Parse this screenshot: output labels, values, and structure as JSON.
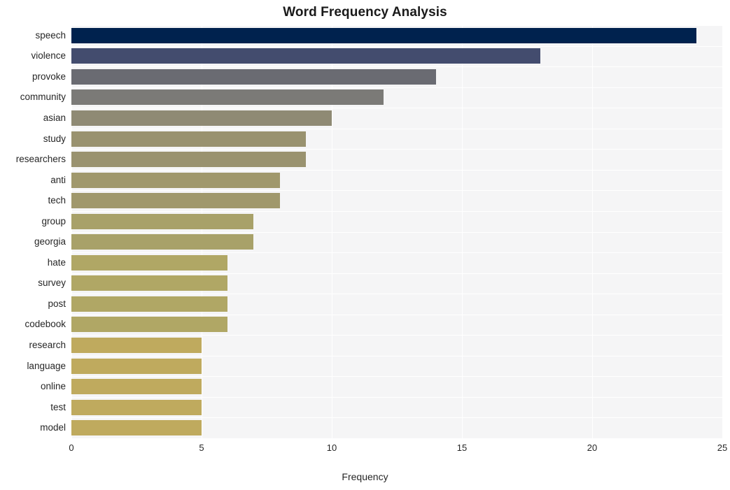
{
  "chart_data": {
    "type": "bar",
    "orientation": "horizontal",
    "title": "Word Frequency Analysis",
    "xlabel": "Frequency",
    "ylabel": "",
    "xlim": [
      0,
      25
    ],
    "ylim": null,
    "grid": true,
    "legend": null,
    "xticks": [
      "0",
      "5",
      "10",
      "15",
      "20",
      "25"
    ],
    "xtick_values": [
      0,
      5,
      10,
      15,
      20,
      25
    ],
    "categories": [
      "speech",
      "violence",
      "provoke",
      "community",
      "asian",
      "study",
      "researchers",
      "anti",
      "tech",
      "group",
      "georgia",
      "hate",
      "survey",
      "post",
      "codebook",
      "research",
      "language",
      "online",
      "test",
      "model"
    ],
    "values": [
      24,
      18,
      14,
      12,
      10,
      9,
      9,
      8,
      8,
      7,
      7,
      6,
      6,
      6,
      6,
      5,
      5,
      5,
      5,
      5
    ],
    "colors": [
      "#00224e",
      "#434c6e",
      "#6a6b72",
      "#7b7a77",
      "#8f8a74",
      "#99926f",
      "#99926f",
      "#a0986c",
      "#a0986c",
      "#a8a169",
      "#a8a169",
      "#b0a765",
      "#b0a765",
      "#b0a765",
      "#b0a765",
      "#bfaa5e",
      "#bfaa5e",
      "#bfaa5e",
      "#bfaa5e",
      "#bfaa5e"
    ],
    "plot_background": "#f5f5f6",
    "gridline_color": "#ffffff",
    "colormap": "cividis"
  }
}
